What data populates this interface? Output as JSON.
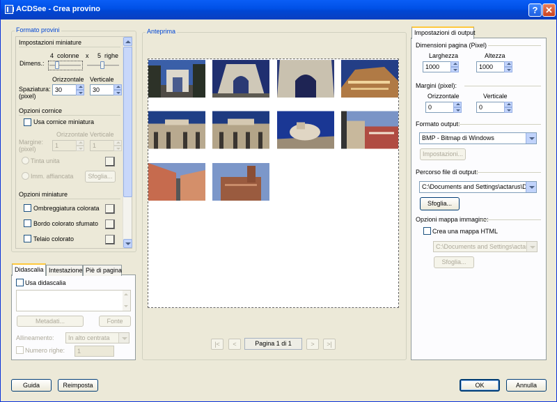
{
  "window": {
    "title": "ACDSee - Crea provino"
  },
  "left": {
    "group_title": "Formato provini",
    "miniature": {
      "title": "Impostazioni miniature",
      "dimens_label": "Dimens.:",
      "columns_value": "4",
      "columns_word": "colonne",
      "times": "x",
      "rows_value": "5",
      "rows_word": "righe",
      "spacing_label_1": "Spaziatura:",
      "spacing_label_2": "(pixel)",
      "horizontal_label": "Orizzontale",
      "vertical_label": "Verticale",
      "horizontal_value": "30",
      "vertical_value": "30"
    },
    "frame": {
      "title": "Opzioni cornice",
      "use_frame": "Usa cornice miniatura",
      "margin_label_1": "Margine:",
      "margin_label_2": "(pixel)",
      "horizontal_label": "Orizzontale",
      "vertical_label": "Verticale",
      "horizontal_value": "1",
      "vertical_value": "1",
      "solid_color": "Tinta unita",
      "tiled_image": "Imm. affiancata",
      "browse": "Sfoglia..."
    },
    "thumb_options": {
      "title": "Opzioni miniature",
      "colored_shadow": "Ombreggiatura colorata",
      "blurred_border": "Bordo colorato sfumato",
      "colored_frame": "Telaio colorato"
    },
    "tabs": [
      "Didascalia",
      "Intestazione",
      "Piè di pagina"
    ],
    "caption": {
      "use_caption": "Usa didascalia",
      "metadata": "Metadati...",
      "font": "Fonte",
      "alignment_label": "Allineamento:",
      "alignment_value": "In alto centrata",
      "row_count_label": "Numero righe:",
      "row_count_value": "1"
    }
  },
  "preview": {
    "title": "Anteprima",
    "page_label": "Pagina 1 di 1",
    "nav": [
      "|<",
      "<",
      ">",
      ">|"
    ],
    "thumbnail_count": 10
  },
  "right": {
    "tab": "Impostazioni di output",
    "page_size": {
      "title": "Dimensioni pagina (Pixel)",
      "width_label": "Larghezza",
      "height_label": "Altezza",
      "width_value": "1000",
      "height_value": "1000"
    },
    "margins": {
      "title": "Margini (pixel):",
      "horizontal_label": "Orizzontale",
      "vertical_label": "Verticale",
      "horizontal_value": "0",
      "vertical_value": "0"
    },
    "output_format": {
      "title": "Formato output:",
      "value": "BMP - Bitmap di Windows",
      "settings": "Impostazioni..."
    },
    "output_path": {
      "title": "Percorso file di output:",
      "value": "C:\\Documents and Settings\\actarus\\Des",
      "browse": "Sfoglia..."
    },
    "image_map": {
      "title": "Opzioni mappa immagine:",
      "create": "Crea una mappa HTML",
      "path": "C:\\Documents and Settings\\actarus",
      "browse": "Sfoglia..."
    }
  },
  "footer": {
    "help": "Guida",
    "reset": "Reimposta",
    "ok": "OK",
    "cancel": "Annulla"
  }
}
